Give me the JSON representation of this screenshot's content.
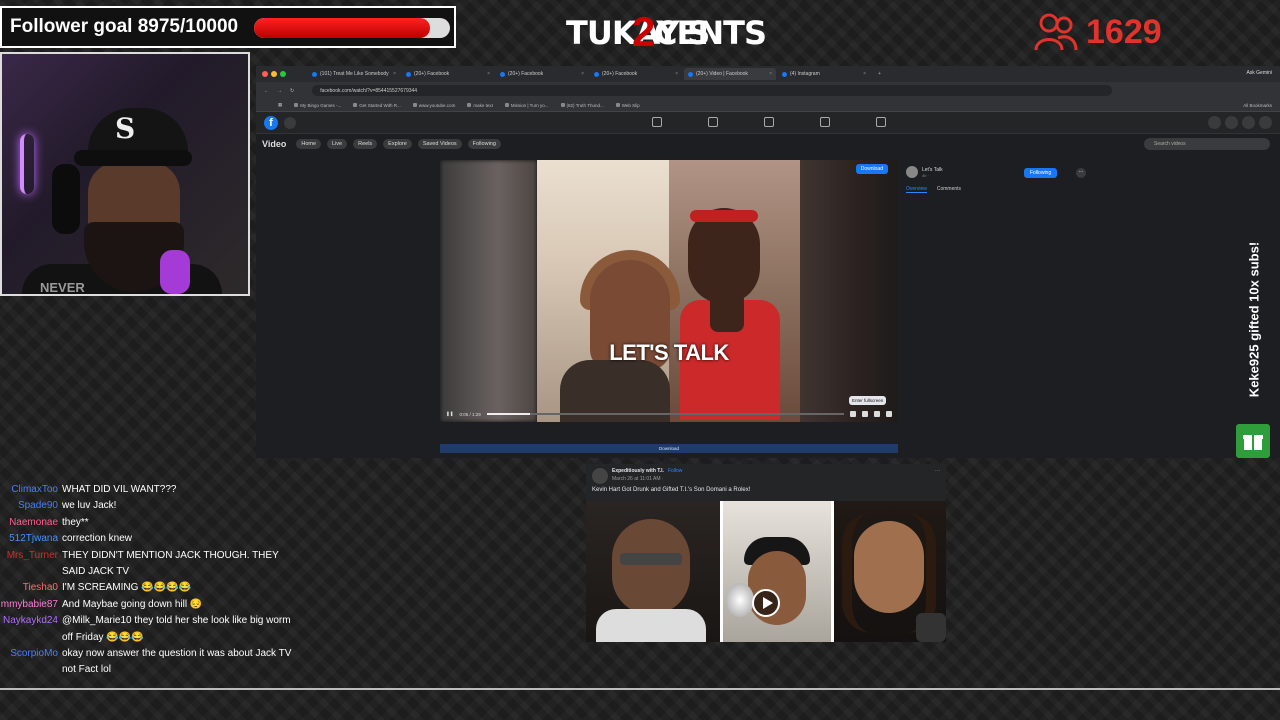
{
  "overlay": {
    "follower_goal_text": "Follower goal 8975/10000",
    "follower_progress": 0.8975,
    "logo_text": "TUKAY'S",
    "logo_num": "2",
    "logo_text2": "CENTS",
    "viewer_count": "1629",
    "gift_text": "Keke925 gifted 10x subs!",
    "colors": {
      "accent_red": "#e0332b",
      "gift_green": "#2e9d3a",
      "fb_blue": "#1877f2"
    }
  },
  "webcam": {
    "shirt_text": "NEVER"
  },
  "browser": {
    "tabs": [
      {
        "label": "(101) Treat Me Like Somebody",
        "active": false
      },
      {
        "label": "(20+) Facebook",
        "active": false
      },
      {
        "label": "(20+) Facebook",
        "active": false
      },
      {
        "label": "(20+) Facebook",
        "active": false
      },
      {
        "label": "(20+) Video | Facebook",
        "active": true
      },
      {
        "label": "(4) Instagram",
        "active": false
      }
    ],
    "ask_gemini": "Ask Gemini",
    "url": "facebook.com/watch/?v=854415527679344",
    "bookmarks": [
      "My Bingo Games -...",
      "Get Started With R...",
      "www.youtube.com",
      "make text",
      "Mission | Turn yo...",
      "(82) Truth Thund...",
      "Web Slip"
    ],
    "all_bookmarks": "All Bookmarks"
  },
  "facebook": {
    "logo": "f",
    "video_title": "Video",
    "nav": [
      "Home",
      "Live",
      "Reels",
      "Explore",
      "Saved Videos",
      "Following"
    ],
    "search_placeholder": "Search videos",
    "player": {
      "overlay_text": "LET'S TALK",
      "download_label": "Download",
      "tooltip": "Enter fullscreen",
      "time": "0:05 / 1:29",
      "progress": 0.12,
      "below_label": "Download"
    },
    "side": {
      "page_name": "Let's Talk",
      "page_sub": "4h · ",
      "following_label": "Following",
      "more": "···",
      "tabs": [
        "Overview",
        "Comments"
      ]
    },
    "post": {
      "author": "Expeditiously with T.I.",
      "follow": "Follow",
      "date": "March 26 at 11:01 AM · ",
      "caption": "Kevin Hart Got Drunk and Gifted T.I.'s Son Domani a Rolex!",
      "menu": "···"
    }
  },
  "chat": [
    {
      "user": "ClimaxToo",
      "color": "#4a7cff",
      "msg": "WHAT DID VIL WANT???"
    },
    {
      "user": "Spade90",
      "color": "#4a7cff",
      "msg": "we luv Jack!"
    },
    {
      "user": "Naemonae",
      "color": "#ff5d8f",
      "msg": "they**"
    },
    {
      "user": "512Tjwana",
      "color": "#4a90ff",
      "msg": "correction knew"
    },
    {
      "user": "Mrs_Turner",
      "color": "#d62a2a",
      "msg": "THEY DIDN'T MENTION JACK THOUGH. THEY SAID JACK TV"
    },
    {
      "user": "Tiesha0",
      "color": "#ff6b6b",
      "msg": "I'M SCREAMING 😂😂😂😂"
    },
    {
      "user": "mmybabie87",
      "color": "#ff7ad9",
      "msg": "And Maybae going down hill 😔"
    },
    {
      "user": "Naykaykd24",
      "color": "#b06cff",
      "msg": "@Milk_Marie10 they told her she look like big worm off Friday 😂😂😂"
    },
    {
      "user": "ScorpioMo",
      "color": "#4a7cff",
      "msg": "okay now answer the question it was about Jack TV not Fact lol"
    }
  ]
}
